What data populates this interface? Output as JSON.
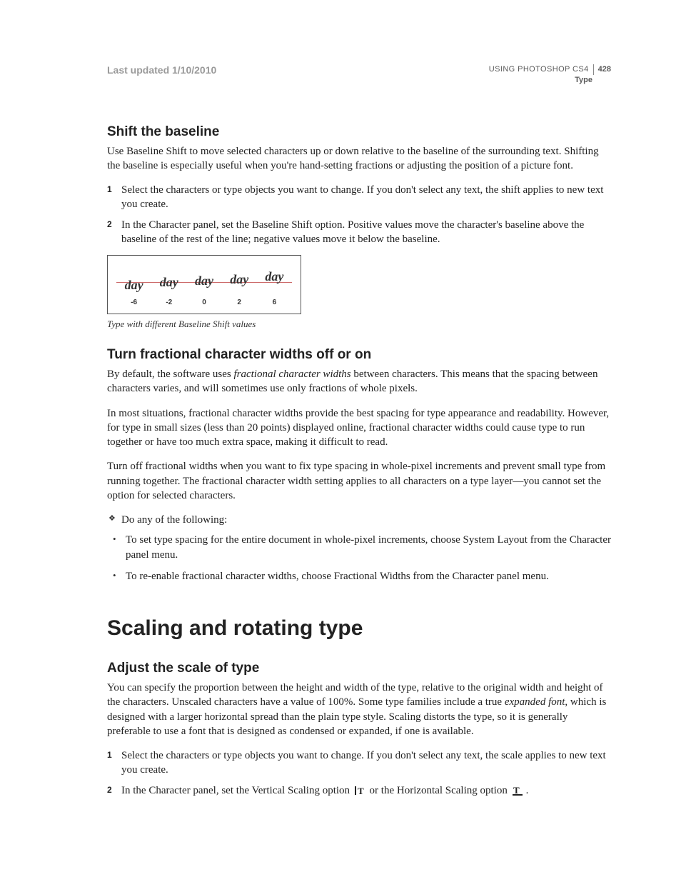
{
  "header": {
    "last_updated": "Last updated 1/10/2010",
    "product": "USING PHOTOSHOP CS4",
    "page_number": "428",
    "section": "Type"
  },
  "section_shift": {
    "heading": "Shift the baseline",
    "intro": "Use Baseline Shift to move selected characters up or down relative to the baseline of the surrounding text. Shifting the baseline is especially useful when you're hand-setting fractions or adjusting the position of a picture font.",
    "steps": [
      "Select the characters or type objects you want to change. If you don't select any text, the shift applies to new text you create.",
      "In the Character panel, set the Baseline Shift option. Positive values move the character's baseline above the baseline of the rest of the line; negative values move it below the baseline."
    ],
    "figure": {
      "word": "day",
      "values": [
        "-6",
        "-2",
        "0",
        "2",
        "6"
      ],
      "caption": "Type with different Baseline Shift values"
    }
  },
  "section_fractional": {
    "heading": "Turn fractional character widths off or on",
    "para1_a": "By default, the software uses ",
    "para1_em": "fractional character widths",
    "para1_b": " between characters. This means that the spacing between characters varies, and will sometimes use only fractions of whole pixels.",
    "para2": "In most situations, fractional character widths provide the best spacing for type appearance and readability. However, for type in small sizes (less than 20 points) displayed online, fractional character widths could cause type to run together or have too much extra space, making it difficult to read.",
    "para3": "Turn off fractional widths when you want to fix type spacing in whole-pixel increments and prevent small type from running together. The fractional character width setting applies to all characters on a type layer—you cannot set the option for selected characters.",
    "do_any": "Do any of the following:",
    "bullets": [
      "To set type spacing for the entire document in whole-pixel increments, choose System Layout from the Character panel menu.",
      "To re-enable fractional character widths, choose Fractional Widths from the Character panel menu."
    ]
  },
  "chapter": {
    "title": "Scaling and rotating type"
  },
  "section_scale": {
    "heading": "Adjust the scale of type",
    "para1_a": "You can specify the proportion between the height and width of the type, relative to the original width and height of the characters. Unscaled characters have a value of 100%. Some type families include a true ",
    "para1_em": "expanded font",
    "para1_b": ", which is designed with a larger horizontal spread than the plain type style. Scaling distorts the type, so it is generally preferable to use a font that is designed as condensed or expanded, if one is available.",
    "step1": "Select the characters or type objects you want to change. If you don't select any text, the scale applies to new text you create.",
    "step2_a": "In the Character panel, set the Vertical Scaling option ",
    "step2_b": " or the Horizontal Scaling option ",
    "step2_c": "."
  },
  "icons": {
    "vertical_scale": "vertical-scale-icon",
    "horizontal_scale": "horizontal-scale-icon"
  }
}
